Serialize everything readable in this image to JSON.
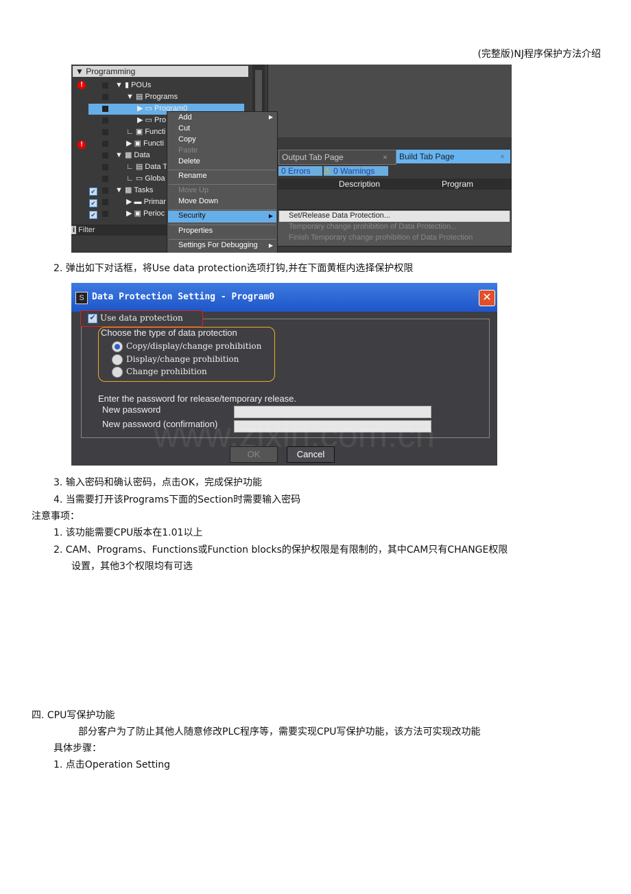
{
  "header": "(完整版)NJ程序保护方法介绍",
  "screenshot1": {
    "panel_title": "Programming",
    "tree": [
      "POUs",
      "Programs",
      "Program0",
      "Pro",
      "Functi",
      "Functi",
      "Data",
      "Data T",
      "Globa",
      "Tasks",
      "Primar",
      "Perioc"
    ],
    "filter": "Filter",
    "context_menu": [
      "Add",
      "Cut",
      "Copy",
      "Paste",
      "Delete",
      "Rename",
      "Move Up",
      "Move Down",
      "Security",
      "Properties",
      "Settings For Debugging"
    ],
    "submenu": [
      "Set/Release Data Protection...",
      "Temporary change prohibition of Data Protection...",
      "Finish Temporary change prohibition of Data Protection"
    ],
    "tabs": [
      "Output Tab Page",
      "Build Tab Page"
    ],
    "errors": "0  Errors",
    "warnings": "0  Warnings",
    "columns": [
      "Description",
      "Program"
    ]
  },
  "step2": "2.   弹出如下对话框，将Use data protection选项打钩,并在下面黄框内选择保护权限",
  "dialog": {
    "title": "Data Protection Setting - Program0",
    "use_protection": "Use data protection",
    "use_protection_checked": true,
    "choose_label": "Choose the type of data protection",
    "options": [
      "Copy/display/change prohibition",
      "Display/change prohibition",
      "Change prohibition"
    ],
    "selected_option": 0,
    "password_prompt": "Enter the password for release/temporary release.",
    "new_password_label": "New password",
    "new_password_value": "",
    "confirm_label": "New password (confirmation)",
    "confirm_value": "",
    "ok": "OK",
    "cancel": "Cancel",
    "watermark": "www.zixin.com.cn"
  },
  "step3": "3.   输入密码和确认密码，点击OK，完成保护功能",
  "step4": "4.   当需要打开该Programs下面的Section时需要输入密码",
  "notes_title": "注意事项：",
  "note1": "1.   该功能需要CPU版本在1.01以上",
  "note2a": "2.   CAM、Programs、Functions或Function blocks的保护权限是有限制的，其中CAM只有CHANGE权限",
  "note2b": "设置，其他3个权限均有可选",
  "section4_title": "四. CPU写保护功能",
  "section4_para1": "部分客户为了防止其他人随意修改PLC程序等，需要实现CPU写保护功能，该方法可实现改功能",
  "section4_para2": "具体步骤：",
  "section4_step1": "1.   点击Operation Setting"
}
